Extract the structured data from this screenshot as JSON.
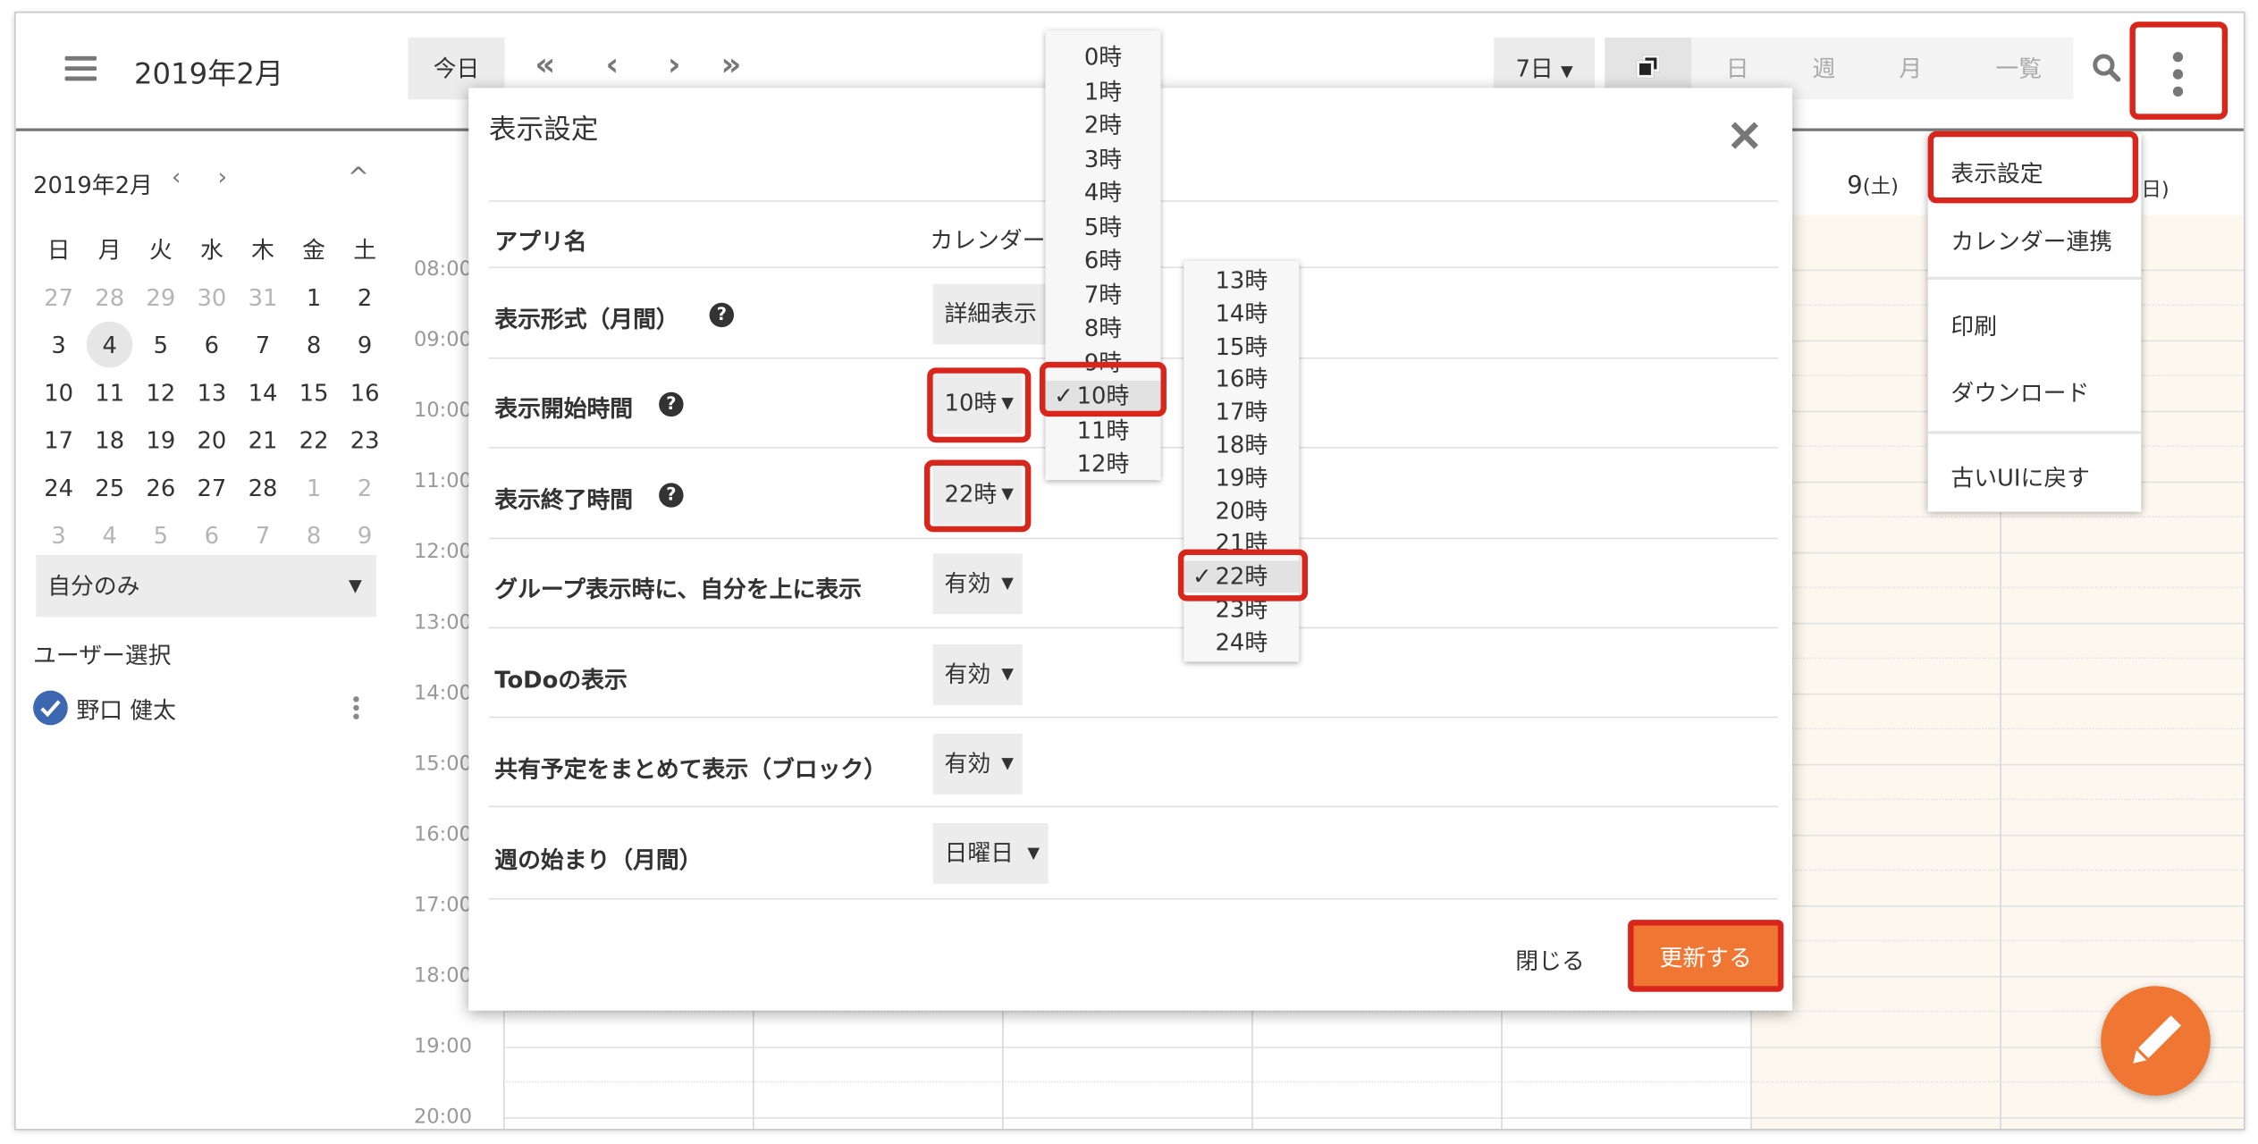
{
  "header": {
    "month_title": "2019年2月",
    "today_label": "今日",
    "range_select": "7日",
    "views": [
      "日",
      "週",
      "月",
      "一覧"
    ]
  },
  "sidebar": {
    "mini_title": "2019年2月",
    "weekdays": [
      "日",
      "月",
      "火",
      "水",
      "木",
      "金",
      "土"
    ],
    "weeks": [
      [
        {
          "d": "27",
          "dim": true
        },
        {
          "d": "28",
          "dim": true
        },
        {
          "d": "29",
          "dim": true
        },
        {
          "d": "30",
          "dim": true
        },
        {
          "d": "31",
          "dim": true
        },
        {
          "d": "1"
        },
        {
          "d": "2"
        }
      ],
      [
        {
          "d": "3"
        },
        {
          "d": "4",
          "sel": true
        },
        {
          "d": "5"
        },
        {
          "d": "6"
        },
        {
          "d": "7"
        },
        {
          "d": "8"
        },
        {
          "d": "9"
        }
      ],
      [
        {
          "d": "10"
        },
        {
          "d": "11"
        },
        {
          "d": "12"
        },
        {
          "d": "13"
        },
        {
          "d": "14"
        },
        {
          "d": "15"
        },
        {
          "d": "16"
        }
      ],
      [
        {
          "d": "17"
        },
        {
          "d": "18"
        },
        {
          "d": "19"
        },
        {
          "d": "20"
        },
        {
          "d": "21"
        },
        {
          "d": "22"
        },
        {
          "d": "23"
        }
      ],
      [
        {
          "d": "24"
        },
        {
          "d": "25"
        },
        {
          "d": "26"
        },
        {
          "d": "27"
        },
        {
          "d": "28"
        },
        {
          "d": "1",
          "dim": true
        },
        {
          "d": "2",
          "dim": true
        }
      ],
      [
        {
          "d": "3",
          "dim": true
        },
        {
          "d": "4",
          "dim": true
        },
        {
          "d": "5",
          "dim": true
        },
        {
          "d": "6",
          "dim": true
        },
        {
          "d": "7",
          "dim": true
        },
        {
          "d": "8",
          "dim": true
        },
        {
          "d": "9",
          "dim": true
        }
      ]
    ],
    "scope_select": "自分のみ",
    "user_select_label": "ユーザー選択",
    "user_name": "野口 健太"
  },
  "calendar": {
    "times": [
      "08:00",
      "09:00",
      "10:00",
      "11:00",
      "12:00",
      "13:00",
      "14:00",
      "15:00",
      "16:00",
      "17:00",
      "18:00",
      "19:00",
      "20:00"
    ],
    "sat_day": "9",
    "sat_wd": "(土)",
    "sun_wd_partial": "日)"
  },
  "dialog": {
    "title": "表示設定",
    "app_name_label": "アプリ名",
    "app_name_value": "カレンダー",
    "rows": [
      {
        "label": "表示形式（月間）",
        "value": "詳細表示"
      },
      {
        "label": "表示開始時間",
        "value": "10時"
      },
      {
        "label": "表示終了時間",
        "value": "22時"
      },
      {
        "label": "グループ表示時に、自分を上に表示",
        "value": "有効"
      },
      {
        "label": "ToDoの表示",
        "value": "有効"
      },
      {
        "label": "共有予定をまとめて表示（ブロック）",
        "value": "有効"
      },
      {
        "label": "週の始まり（月間）",
        "value": "日曜日"
      }
    ],
    "close_label": "閉じる",
    "update_label": "更新する"
  },
  "start_hours": [
    "0時",
    "1時",
    "2時",
    "3時",
    "4時",
    "5時",
    "6時",
    "7時",
    "8時",
    "9時",
    "10時",
    "11時",
    "12時"
  ],
  "start_selected": "10時",
  "end_hours": [
    "13時",
    "14時",
    "15時",
    "16時",
    "17時",
    "18時",
    "19時",
    "20時",
    "21時",
    "22時",
    "23時",
    "24時"
  ],
  "end_selected": "22時",
  "context_menu": {
    "items": [
      "表示設定",
      "カレンダー連携",
      "印刷",
      "ダウンロード",
      "古いUIに戻す"
    ]
  },
  "colors": {
    "accent": "#ef7733",
    "highlight": "#d9261c",
    "check": "#3e67b1"
  }
}
